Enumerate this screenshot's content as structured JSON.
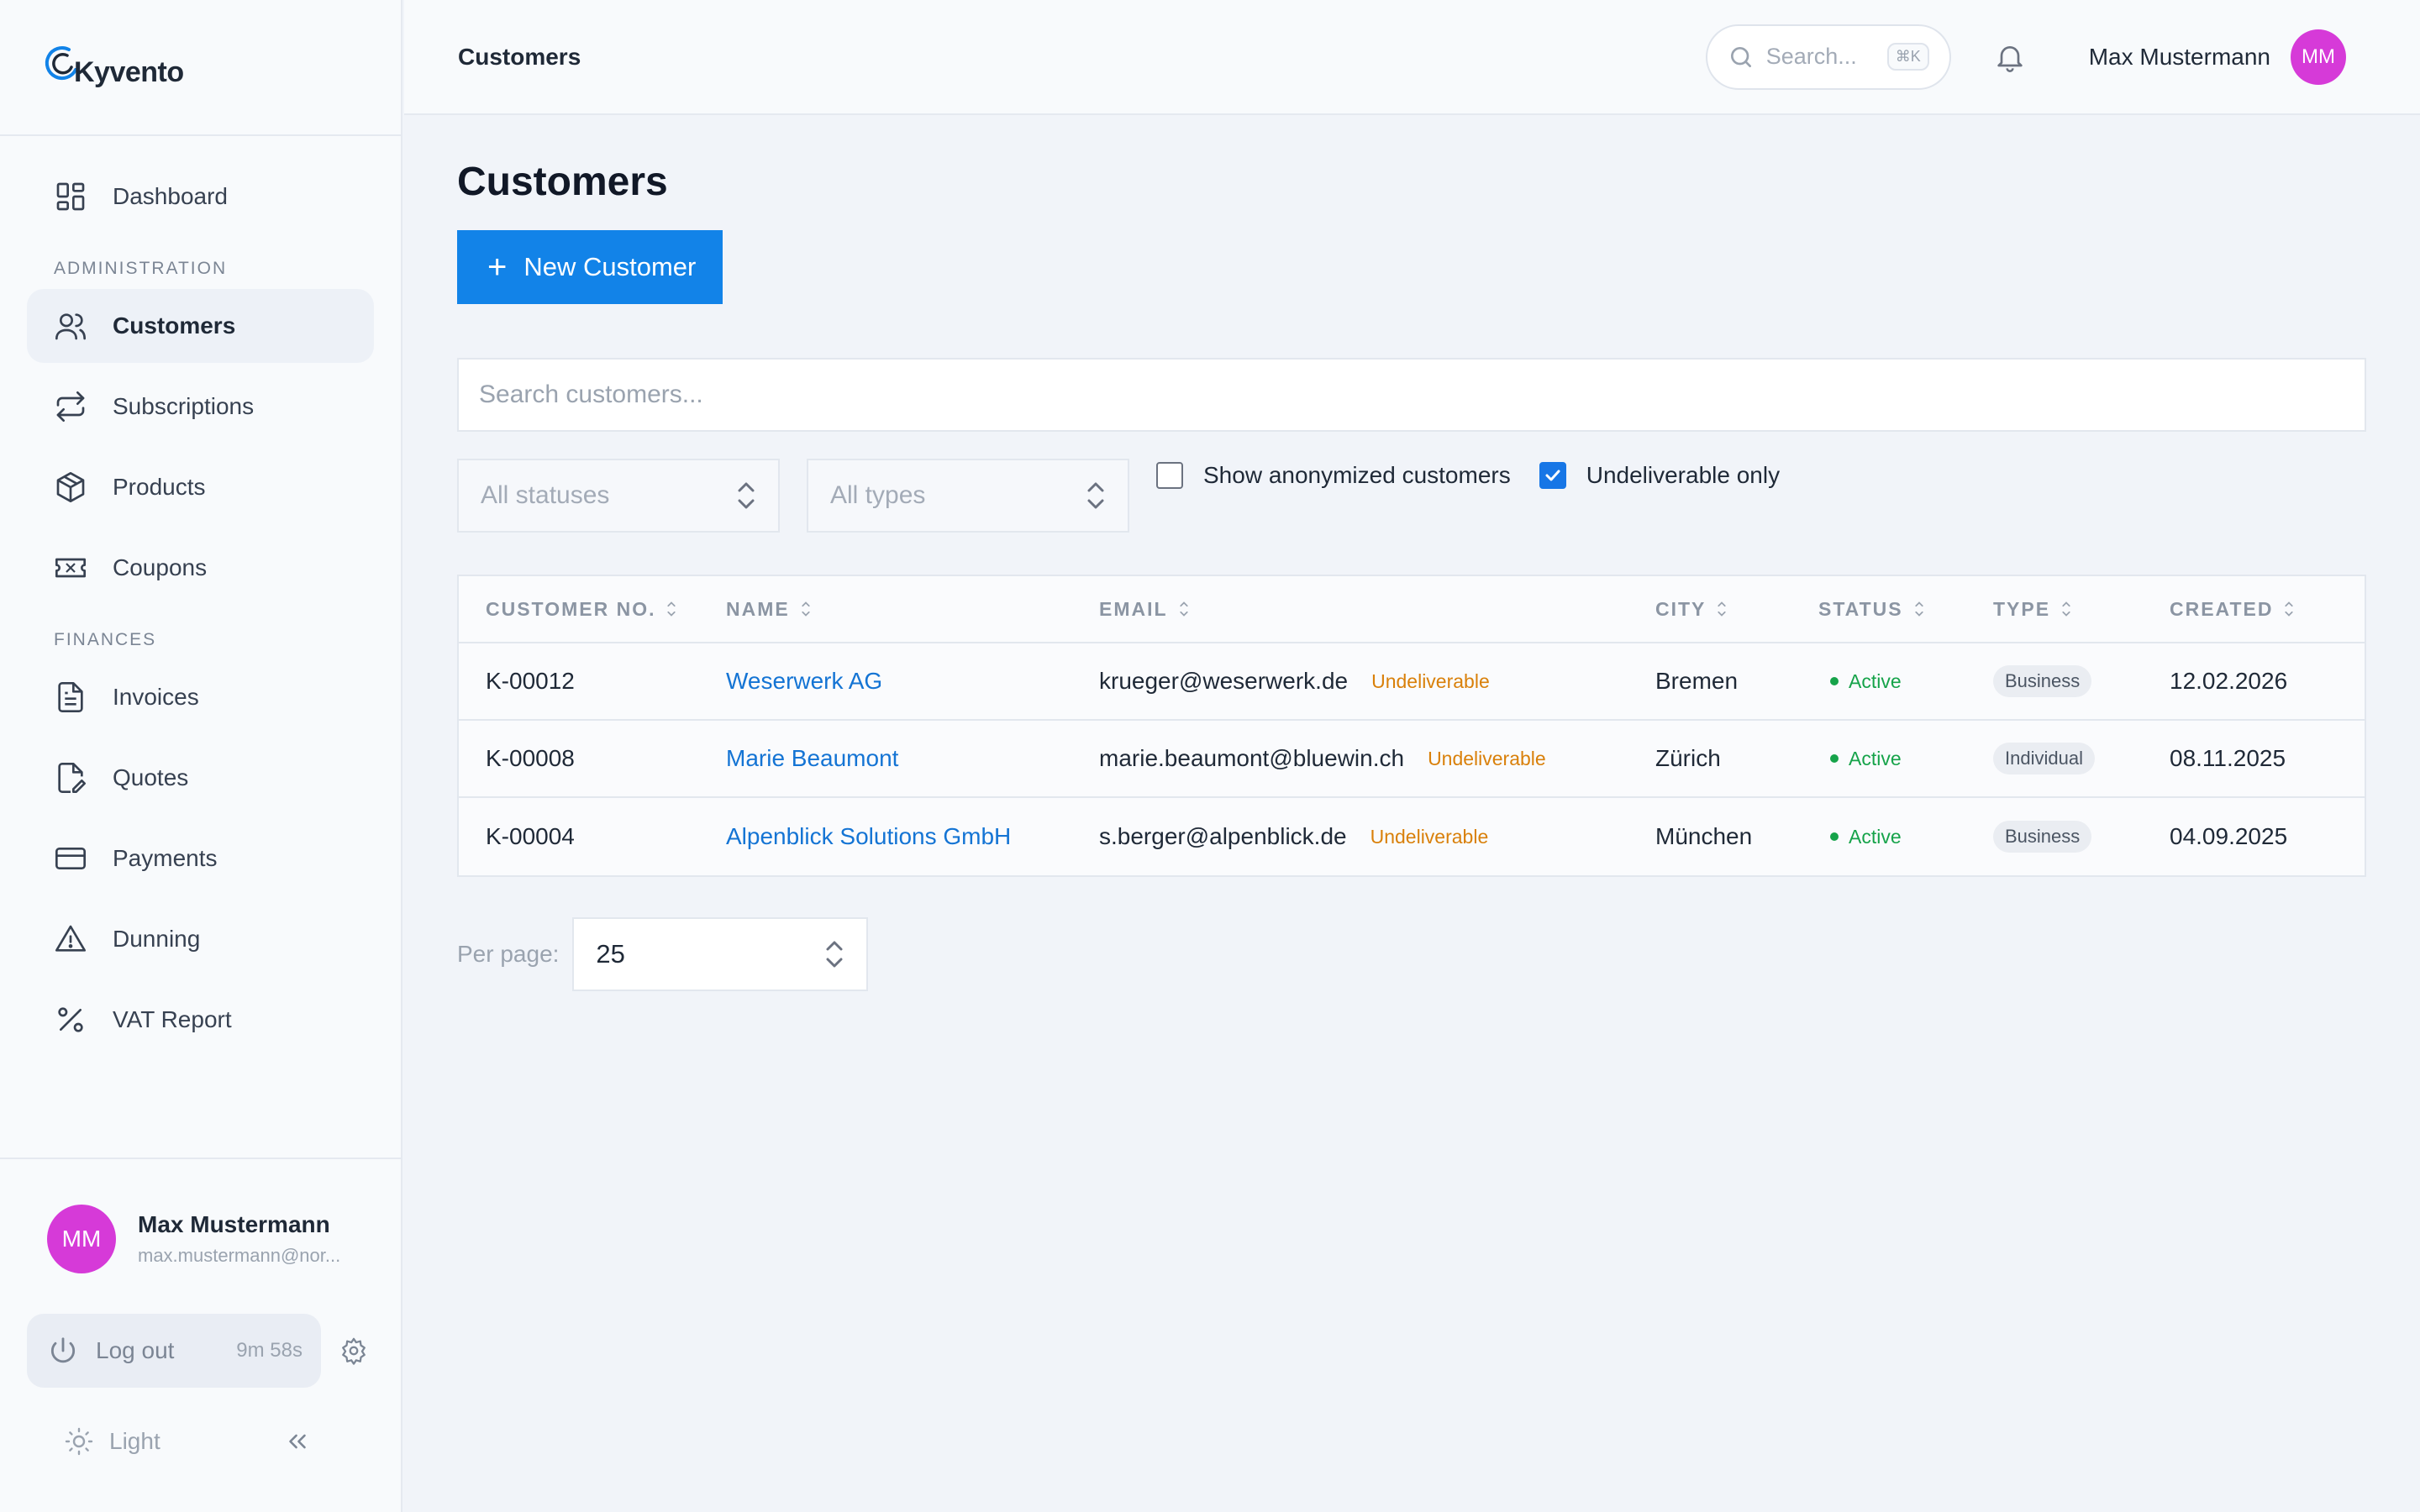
{
  "app": {
    "brand": "Kyvento"
  },
  "colors": {
    "accent": "#1283e8",
    "avatar": "#d63ad8",
    "status_active": "#16a34a",
    "undeliverable": "#d9800a"
  },
  "sidebar": {
    "dashboard": {
      "label": "Dashboard",
      "icon": "grid-icon"
    },
    "section_admin": "ADMINISTRATION",
    "admin_items": [
      {
        "label": "Customers",
        "icon": "users-icon",
        "active": true
      },
      {
        "label": "Subscriptions",
        "icon": "repeat-icon"
      },
      {
        "label": "Products",
        "icon": "box-icon"
      },
      {
        "label": "Coupons",
        "icon": "ticket-icon"
      }
    ],
    "section_finances": "FINANCES",
    "finance_items": [
      {
        "label": "Invoices",
        "icon": "document-icon"
      },
      {
        "label": "Quotes",
        "icon": "file-edit-icon"
      },
      {
        "label": "Payments",
        "icon": "credit-card-icon"
      },
      {
        "label": "Dunning",
        "icon": "warning-icon"
      },
      {
        "label": "VAT Report",
        "icon": "percent-icon"
      }
    ],
    "user": {
      "initials": "MM",
      "name": "Max Mustermann",
      "email": "max.mustermann@nor..."
    },
    "logout": {
      "label": "Log out",
      "timer": "9m 58s"
    },
    "theme": {
      "label": "Light"
    }
  },
  "header": {
    "breadcrumb": "Customers",
    "search_placeholder": "Search...",
    "shortcut": "⌘K",
    "user_name": "Max Mustermann",
    "user_initials": "MM"
  },
  "main": {
    "title": "Customers",
    "new_button": "New Customer",
    "search_placeholder": "Search customers...",
    "status_filter": "All statuses",
    "type_filter": "All types",
    "show_anonymized": {
      "label": "Show anonymized customers",
      "checked": false
    },
    "undeliverable_only": {
      "label": "Undeliverable only",
      "checked": true
    },
    "columns": [
      "CUSTOMER NO.",
      "NAME",
      "EMAIL",
      "CITY",
      "STATUS",
      "TYPE",
      "CREATED"
    ],
    "rows": [
      {
        "no": "K-00012",
        "name": "Weserwerk AG",
        "email": "krueger@weserwerk.de",
        "flag": "Undeliverable",
        "city": "Bremen",
        "status": "Active",
        "type": "Business",
        "created": "12.02.2026"
      },
      {
        "no": "K-00008",
        "name": "Marie Beaumont",
        "email": "marie.beaumont@bluewin.ch",
        "flag": "Undeliverable",
        "city": "Zürich",
        "status": "Active",
        "type": "Individual",
        "created": "08.11.2025"
      },
      {
        "no": "K-00004",
        "name": "Alpenblick Solutions GmbH",
        "email": "s.berger@alpenblick.de",
        "flag": "Undeliverable",
        "city": "München",
        "status": "Active",
        "type": "Business",
        "created": "04.09.2025"
      }
    ],
    "per_page_label": "Per page:",
    "per_page_value": "25"
  }
}
